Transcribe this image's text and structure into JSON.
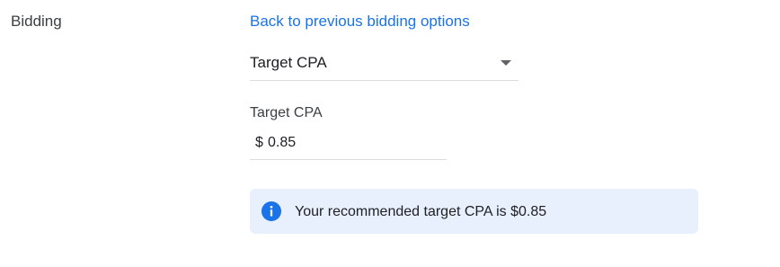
{
  "section": {
    "label": "Bidding"
  },
  "back_link": {
    "label": "Back to previous bidding options"
  },
  "bid_strategy_select": {
    "selected": "Target CPA"
  },
  "target_cpa": {
    "label": "Target CPA",
    "currency_prefix": "$",
    "value": "0.85"
  },
  "recommendation": {
    "icon": "info-icon",
    "text": "Your recommended target CPA is $0.85"
  },
  "colors": {
    "link": "#1a73e8",
    "info_background": "#e8f0fe",
    "info_icon": "#1a73e8",
    "divider": "#dadce0"
  }
}
